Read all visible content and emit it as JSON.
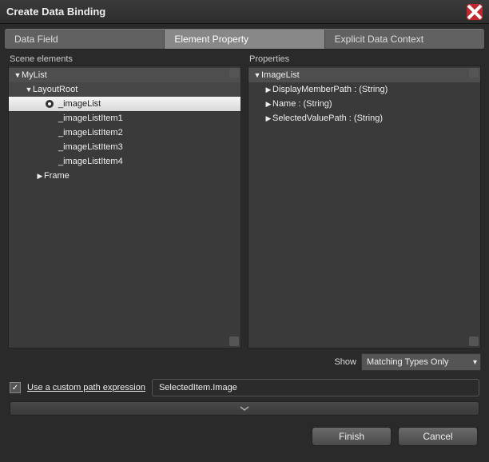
{
  "window": {
    "title": "Create Data Binding"
  },
  "tabs": {
    "data_field": "Data Field",
    "element_property": "Element Property",
    "explicit_context": "Explicit Data Context"
  },
  "panes": {
    "scene_label": "Scene elements",
    "properties_label": "Properties"
  },
  "scene_tree": {
    "root": "MyList",
    "layout": "LayoutRoot",
    "imagelist": "_imageList",
    "items": [
      "_imageListItem1",
      "_imageListItem2",
      "_imageListItem3",
      "_imageListItem4"
    ],
    "frame": "Frame"
  },
  "prop_tree": {
    "root": "ImageList",
    "p1": "DisplayMemberPath : (String)",
    "p2": "Name : (String)",
    "p3": "SelectedValuePath : (String)"
  },
  "show": {
    "label": "Show",
    "value": "Matching Types Only"
  },
  "custom": {
    "label": "Use a custom path expression",
    "value": "SelectedItem.Image",
    "checked": true
  },
  "buttons": {
    "finish": "Finish",
    "cancel": "Cancel"
  }
}
